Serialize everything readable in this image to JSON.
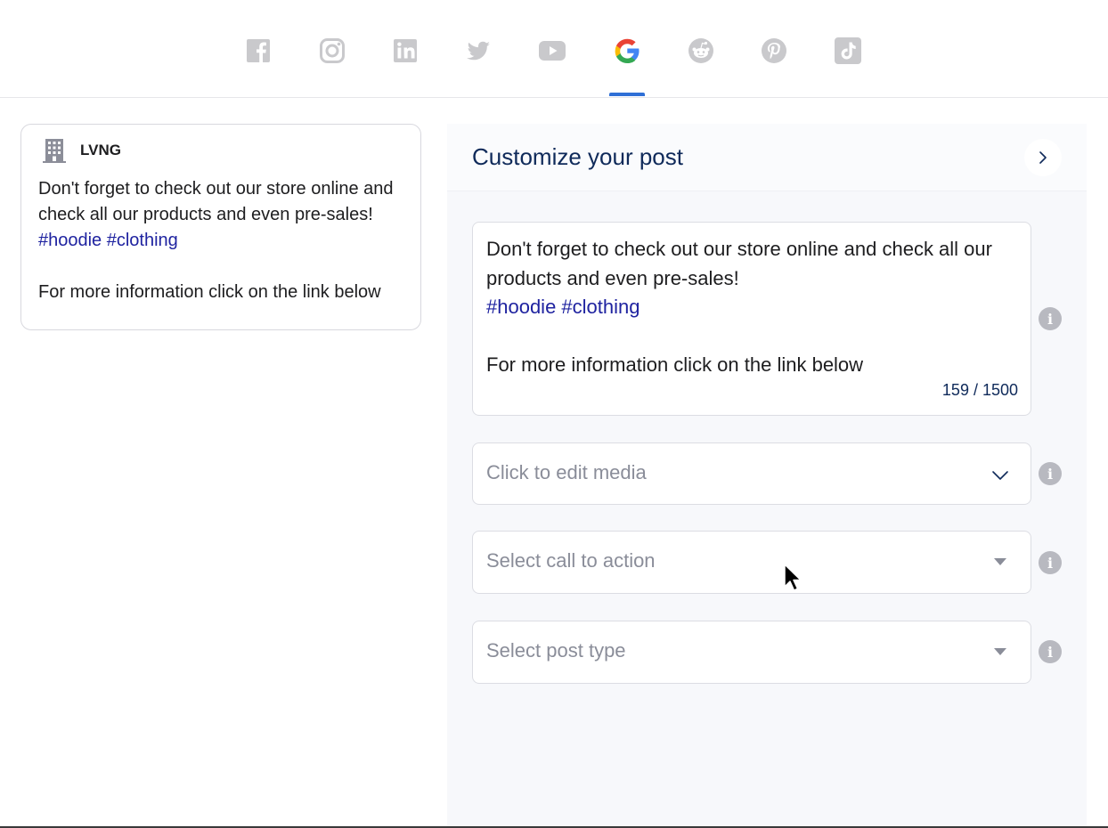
{
  "networks": {
    "items": [
      {
        "name": "facebook-tab-icon",
        "active": false
      },
      {
        "name": "instagram-tab-icon",
        "active": false
      },
      {
        "name": "linkedin-tab-icon",
        "active": false
      },
      {
        "name": "twitter-tab-icon",
        "active": false
      },
      {
        "name": "youtube-tab-icon",
        "active": false
      },
      {
        "name": "google-tab-icon",
        "active": true
      },
      {
        "name": "reddit-tab-icon",
        "active": false
      },
      {
        "name": "pinterest-tab-icon",
        "active": false
      },
      {
        "name": "tiktok-tab-icon",
        "active": false
      }
    ],
    "inactive_color": "#c9c9cc",
    "active_underline_color": "#2f6fd6"
  },
  "preview": {
    "account_icon": "building-icon",
    "account_name": "LVNG",
    "text_line1": "Don't forget to check out our store online and check all our products and even pre-sales!",
    "hashtags": "#hoodie #clothing",
    "text_line2": "For more information click on the link below"
  },
  "customize": {
    "title": "Customize your post",
    "next_icon": "chevron-right-icon",
    "post_text": {
      "line1": "Don't forget to check out our store online and check all our products and even pre-sales!",
      "hashtags": "#hoodie #clothing",
      "line2": "For more information click on the link below",
      "counter": "159 / 1500"
    },
    "media": {
      "placeholder": "Click to edit media",
      "icon": "chevron-down-icon"
    },
    "call_to_action": {
      "placeholder": "Select call to action",
      "icon": "caret-down-icon"
    },
    "post_type": {
      "placeholder": "Select post type",
      "icon": "caret-down-icon"
    },
    "info_icon": "info-icon"
  },
  "colors": {
    "hashtag": "#1f23a0",
    "title": "#0f2a5a",
    "placeholder": "#8a8d99"
  }
}
